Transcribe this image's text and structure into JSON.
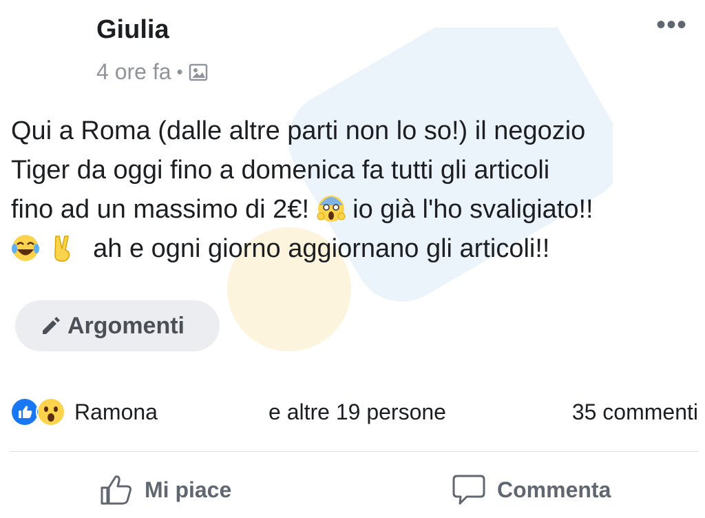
{
  "post": {
    "author": "Giulia",
    "time": "4 ore fa",
    "separator": "•",
    "privacy_icon": "photo-icon",
    "more_label": "•••",
    "text_lines": {
      "l1": "Qui a Roma (dalle altre parti non lo so!) il negozio",
      "l2": "Tiger da oggi fino a domenica fa tutti gli articoli",
      "l3a": "fino ad un massimo di 2€!",
      "l3b": "io già l'ho svaligiato!!",
      "l4": "ah e ogni giorno aggiornano gli articoli!!"
    },
    "emojis": [
      "scream-emoji",
      "tears-of-joy-emoji",
      "victory-hand-emoji"
    ]
  },
  "tag_button": {
    "label": "Argomenti",
    "icon": "pencil-icon"
  },
  "reactions": {
    "icons": [
      "like-icon",
      "wow-icon"
    ],
    "name": "Ramona",
    "others": "e altre 19 persone",
    "comments": "35 commenti"
  },
  "actions": {
    "like_label": "Mi piace",
    "comment_label": "Commenta"
  },
  "colors": {
    "like_blue": "#1877f2",
    "wow_yellow": "#fcd34d",
    "muted_text": "#606770"
  }
}
